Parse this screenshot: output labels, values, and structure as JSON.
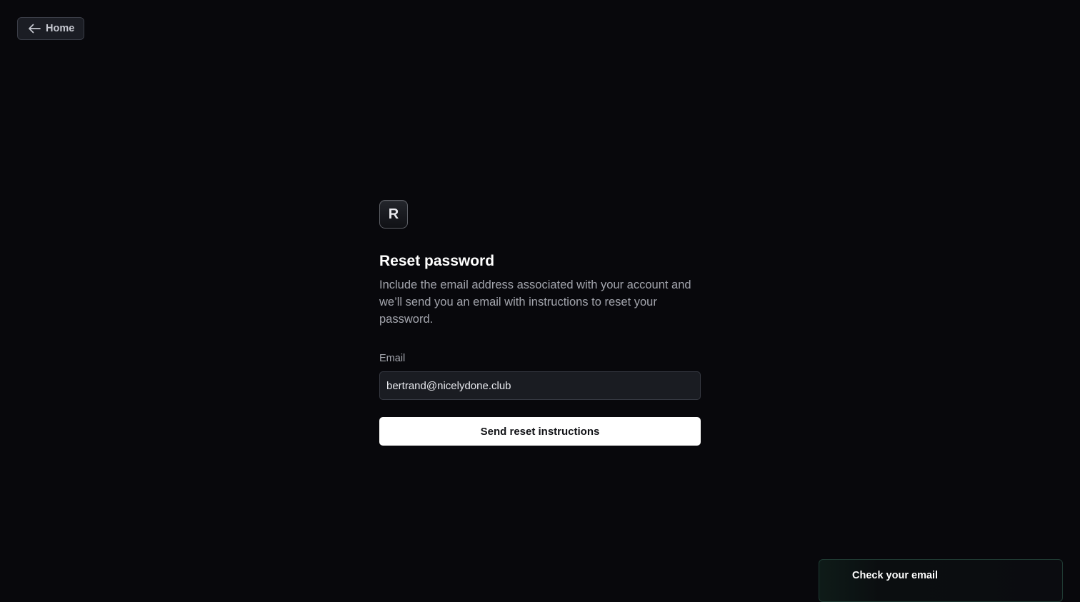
{
  "nav": {
    "home_label": "Home",
    "back_icon": "arrow-left-icon"
  },
  "logo": {
    "letter": "R"
  },
  "form": {
    "title": "Reset password",
    "description": "Include the email address associated with your account and we’ll send you an email with instructions to reset your password.",
    "email_label": "Email",
    "email_value": "bertrand@nicelydone.club",
    "submit_label": "Send reset instructions"
  },
  "toast": {
    "title": "Check your email"
  },
  "colors": {
    "background": "#08080c",
    "button_bg": "#ffffff",
    "muted_text": "#a3a5ad",
    "toast_border": "#1f3a33"
  }
}
